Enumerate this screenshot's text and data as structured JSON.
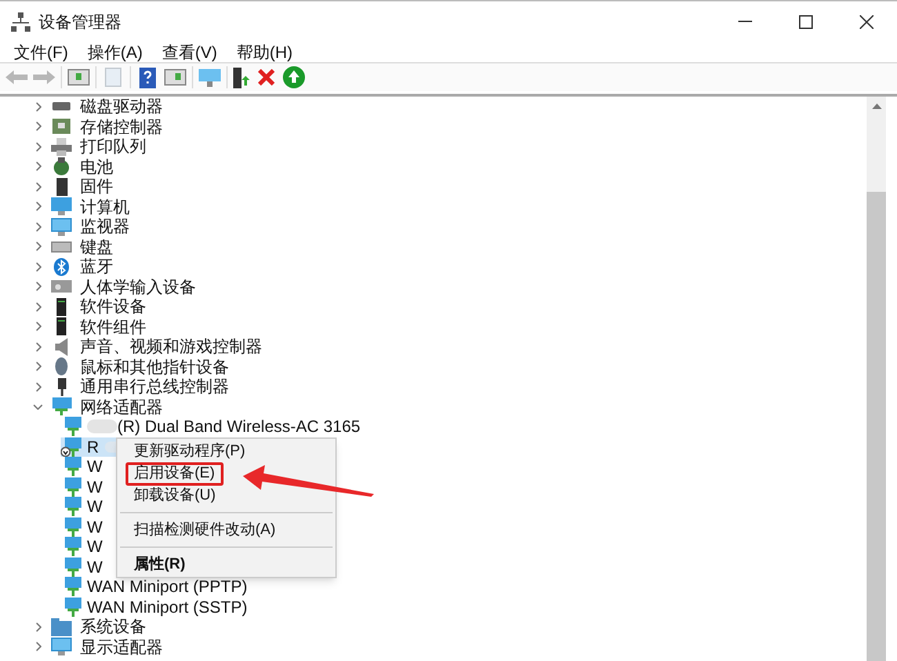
{
  "window": {
    "title": "设备管理器"
  },
  "menu": [
    "文件(F)",
    "操作(A)",
    "查看(V)",
    "帮助(H)"
  ],
  "toolbar": [
    {
      "kind": "back",
      "disabled": true
    },
    {
      "kind": "forward",
      "disabled": true
    },
    {
      "kind": "sep"
    },
    {
      "kind": "pane",
      "disabled": false
    },
    {
      "kind": "sep"
    },
    {
      "kind": "props",
      "disabled": true
    },
    {
      "kind": "sep"
    },
    {
      "kind": "help",
      "disabled": false
    },
    {
      "kind": "pane2",
      "disabled": false
    },
    {
      "kind": "sep"
    },
    {
      "kind": "scan",
      "disabled": false
    },
    {
      "kind": "sep"
    },
    {
      "kind": "update",
      "disabled": false
    },
    {
      "kind": "remove",
      "disabled": false
    },
    {
      "kind": "enable",
      "disabled": false
    }
  ],
  "tree": [
    {
      "label": "磁盘驱动器",
      "kind": "drive",
      "expanded": false
    },
    {
      "label": "存储控制器",
      "kind": "storage",
      "expanded": false
    },
    {
      "label": "打印队列",
      "kind": "printer",
      "expanded": false
    },
    {
      "label": "电池",
      "kind": "battery",
      "expanded": false
    },
    {
      "label": "固件",
      "kind": "firmware",
      "expanded": false
    },
    {
      "label": "计算机",
      "kind": "computer",
      "expanded": false
    },
    {
      "label": "监视器",
      "kind": "monitor",
      "expanded": false
    },
    {
      "label": "键盘",
      "kind": "keyboard",
      "expanded": false
    },
    {
      "label": "蓝牙",
      "kind": "bluetooth",
      "expanded": false
    },
    {
      "label": "人体学输入设备",
      "kind": "hid",
      "expanded": false
    },
    {
      "label": "软件设备",
      "kind": "software",
      "expanded": false
    },
    {
      "label": "软件组件",
      "kind": "software",
      "expanded": false
    },
    {
      "label": "声音、视频和游戏控制器",
      "kind": "sound",
      "expanded": false
    },
    {
      "label": "鼠标和其他指针设备",
      "kind": "mouse",
      "expanded": false
    },
    {
      "label": "通用串行总线控制器",
      "kind": "usb",
      "expanded": false
    },
    {
      "label": "网络适配器",
      "kind": "network",
      "expanded": true,
      "children": [
        {
          "label": "(R) Dual Band Wireless-AC 3165",
          "redacted": true,
          "disabled": false,
          "selected": false
        },
        {
          "label": "R",
          "redacted": true,
          "disabled": true,
          "selected": true
        },
        {
          "label": "W",
          "redacted": false,
          "disabled": false,
          "selected": false
        },
        {
          "label": "W",
          "redacted": false,
          "disabled": false,
          "selected": false
        },
        {
          "label": "W",
          "redacted": false,
          "disabled": false,
          "selected": false
        },
        {
          "label": "W",
          "redacted": false,
          "disabled": false,
          "selected": false
        },
        {
          "label": "W",
          "redacted": false,
          "disabled": false,
          "selected": false
        },
        {
          "label": "W",
          "redacted": false,
          "disabled": false,
          "selected": false
        },
        {
          "label": "WAN Miniport (PPTP)",
          "redacted": false,
          "disabled": false,
          "selected": false
        },
        {
          "label": "WAN Miniport (SSTP)",
          "redacted": false,
          "disabled": false,
          "selected": false
        }
      ]
    },
    {
      "label": "系统设备",
      "kind": "system",
      "expanded": false
    },
    {
      "label": "显示适配器",
      "kind": "monitor",
      "expanded": false
    }
  ],
  "context_menu": [
    {
      "kind": "item",
      "label": "更新驱动程序(P)",
      "highlighted": false,
      "bold": false
    },
    {
      "kind": "item",
      "label": "启用设备(E)",
      "highlighted": true,
      "bold": false
    },
    {
      "kind": "item",
      "label": "卸载设备(U)",
      "highlighted": false,
      "bold": false
    },
    {
      "kind": "separator"
    },
    {
      "kind": "item",
      "label": "扫描检测硬件改动(A)",
      "highlighted": false,
      "bold": false
    },
    {
      "kind": "separator"
    },
    {
      "kind": "item",
      "label": "属性(R)",
      "highlighted": false,
      "bold": true
    }
  ]
}
